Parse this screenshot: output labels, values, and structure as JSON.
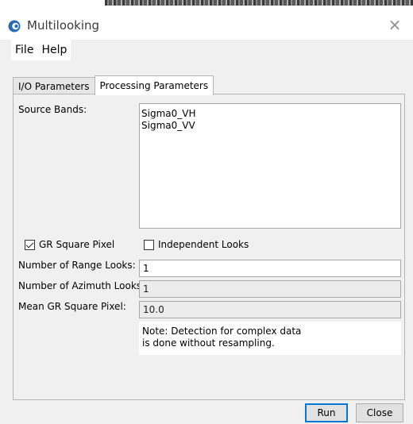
{
  "window": {
    "title": "Multilooking",
    "close_glyph": "×"
  },
  "menu": {
    "items": [
      "File",
      "Help"
    ]
  },
  "tabs": [
    {
      "label": "I/O Parameters",
      "active": false
    },
    {
      "label": "Processing Parameters",
      "active": true
    }
  ],
  "params": {
    "source_bands_label": "Source Bands:",
    "source_bands": [
      "Sigma0_VH",
      "Sigma0_VV"
    ],
    "gr_square_pixel": {
      "label": "GR Square Pixel",
      "checked": true
    },
    "independent_looks": {
      "label": "Independent Looks",
      "checked": false
    },
    "range_looks": {
      "label": "Number of Range Looks:",
      "value": "1"
    },
    "azimuth_looks": {
      "label": "Number of Azimuth Looks:",
      "value": "1"
    },
    "mean_gr_square_pixel": {
      "label": "Mean GR Square Pixel:",
      "value": "10.0"
    },
    "note": [
      "Note: Detection for complex data",
      "is done without resampling."
    ]
  },
  "buttons": {
    "run": "Run",
    "close": "Close"
  },
  "colors": {
    "default_button_border": "#0078d7",
    "app_icon": "#2a6db5"
  },
  "icons": {
    "app": "esa-snap-app-icon",
    "close": "close-icon"
  }
}
